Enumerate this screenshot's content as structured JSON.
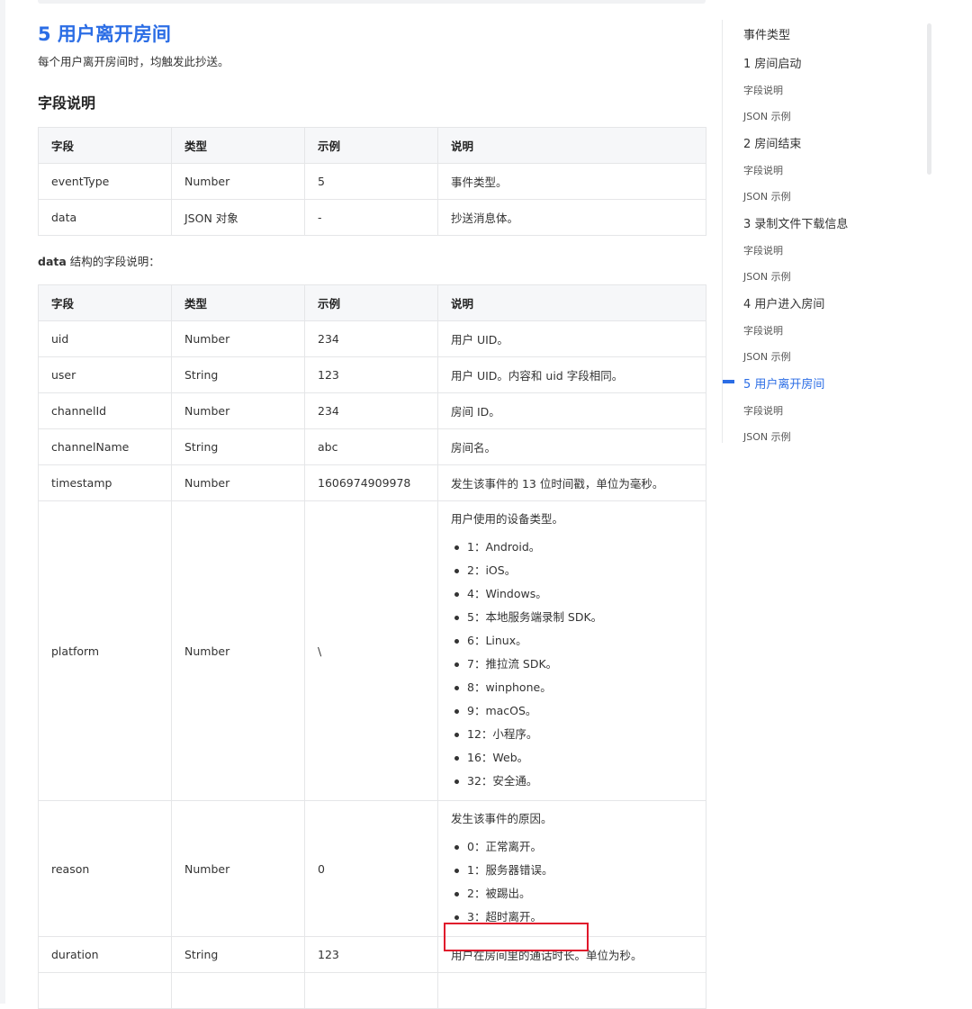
{
  "page": {
    "title": "5 用户离开房间",
    "intro": "每个用户离开房间时，均触发此抄送。",
    "section_title": "字段说明",
    "data_note_bold": "data",
    "data_note_rest": " 结构的字段说明："
  },
  "table1": {
    "headers": [
      "字段",
      "类型",
      "示例",
      "说明"
    ],
    "rows": [
      [
        "eventType",
        "Number",
        "5",
        "事件类型。"
      ],
      [
        "data",
        "JSON 对象",
        "-",
        "抄送消息体。"
      ]
    ]
  },
  "table2": {
    "headers": [
      "字段",
      "类型",
      "示例",
      "说明"
    ],
    "rows": [
      {
        "field": "uid",
        "type": "Number",
        "example": "234",
        "desc": "用户 UID。"
      },
      {
        "field": "user",
        "type": "String",
        "example": "123",
        "desc": "用户 UID。内容和 uid 字段相同。"
      },
      {
        "field": "channelId",
        "type": "Number",
        "example": "234",
        "desc": "房间 ID。"
      },
      {
        "field": "channelName",
        "type": "String",
        "example": "abc",
        "desc": "房间名。"
      },
      {
        "field": "timestamp",
        "type": "Number",
        "example": "1606974909978",
        "desc": "发生该事件的 13 位时间戳，单位为毫秒。"
      }
    ],
    "platform": {
      "field": "platform",
      "type": "Number",
      "example": "\\",
      "desc": "用户使用的设备类型。",
      "items": [
        "1：Android。",
        "2：iOS。",
        "4：Windows。",
        "5：本地服务端录制 SDK。",
        "6：Linux。",
        "7：推拉流 SDK。",
        "8：winphone。",
        "9：macOS。",
        "12：小程序。",
        "16：Web。",
        "32：安全通。"
      ]
    },
    "reason": {
      "field": "reason",
      "type": "Number",
      "example": "0",
      "desc": "发生该事件的原因。",
      "items": [
        "0：正常离开。",
        "1：服务器错误。",
        "2：被踢出。",
        "3：超时离开。"
      ]
    },
    "duration": {
      "field": "duration",
      "type": "String",
      "example": "123",
      "desc": "用户在房间里的通话时长。单位为秒。"
    }
  },
  "toc": {
    "heading": "事件类型",
    "items": [
      {
        "label": "1 房间启动",
        "level": 1
      },
      {
        "label": "字段说明",
        "level": 2
      },
      {
        "label": "JSON 示例",
        "level": 2
      },
      {
        "label": "2 房间结束",
        "level": 1
      },
      {
        "label": "字段说明",
        "level": 2
      },
      {
        "label": "JSON 示例",
        "level": 2
      },
      {
        "label": "3 录制文件下载信息",
        "level": 1
      },
      {
        "label": "字段说明",
        "level": 2
      },
      {
        "label": "JSON 示例",
        "level": 2
      },
      {
        "label": "4 用户进入房间",
        "level": 1
      },
      {
        "label": "字段说明",
        "level": 2
      },
      {
        "label": "JSON 示例",
        "level": 2
      },
      {
        "label": "5 用户离开房间",
        "level": 1,
        "active": true
      },
      {
        "label": "字段说明",
        "level": 2
      },
      {
        "label": "JSON 示例",
        "level": 2
      }
    ]
  },
  "colors": {
    "accent": "#2b6de5",
    "highlight": "#e0162b"
  }
}
